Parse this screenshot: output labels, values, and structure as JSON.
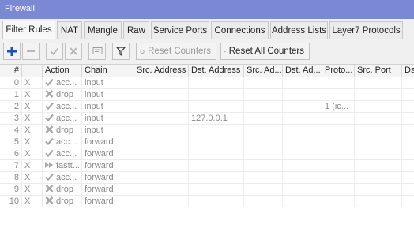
{
  "window": {
    "title": "Firewall"
  },
  "tabs": [
    {
      "label": "Filter Rules",
      "active": true
    },
    {
      "label": "NAT",
      "active": false
    },
    {
      "label": "Mangle",
      "active": false
    },
    {
      "label": "Raw",
      "active": false
    },
    {
      "label": "Service Ports",
      "active": false
    },
    {
      "label": "Connections",
      "active": false
    },
    {
      "label": "Address Lists",
      "active": false
    },
    {
      "label": "Layer7 Protocols",
      "active": false
    }
  ],
  "toolbar": {
    "reset_counters": "Reset Counters",
    "reset_all_counters": "Reset All Counters"
  },
  "table": {
    "columns": [
      "#",
      "",
      "Action",
      "Chain",
      "Src. Address",
      "Dst. Address",
      "Src. Ad...",
      "Dst. Ad...",
      "Proto...",
      "Src. Port",
      "Ds"
    ],
    "rows": [
      {
        "num": "0",
        "flag": "X",
        "action": "acc...",
        "action_icon": "accept-icon",
        "chain": "input",
        "src": "",
        "dst": "",
        "src_list": "",
        "dst_list": "",
        "proto": "",
        "sport": ""
      },
      {
        "num": "1",
        "flag": "X",
        "action": "drop",
        "action_icon": "drop-icon",
        "chain": "input",
        "src": "",
        "dst": "",
        "src_list": "",
        "dst_list": "",
        "proto": "",
        "sport": ""
      },
      {
        "num": "2",
        "flag": "X",
        "action": "acc...",
        "action_icon": "accept-icon",
        "chain": "input",
        "src": "",
        "dst": "",
        "src_list": "",
        "dst_list": "",
        "proto": "1 (ic...",
        "sport": ""
      },
      {
        "num": "3",
        "flag": "X",
        "action": "acc...",
        "action_icon": "accept-icon",
        "chain": "input",
        "src": "",
        "dst": "127.0.0.1",
        "src_list": "",
        "dst_list": "",
        "proto": "",
        "sport": ""
      },
      {
        "num": "4",
        "flag": "X",
        "action": "drop",
        "action_icon": "drop-icon",
        "chain": "input",
        "src": "",
        "dst": "",
        "src_list": "",
        "dst_list": "",
        "proto": "",
        "sport": ""
      },
      {
        "num": "5",
        "flag": "X",
        "action": "acc...",
        "action_icon": "accept-icon",
        "chain": "forward",
        "src": "",
        "dst": "",
        "src_list": "",
        "dst_list": "",
        "proto": "",
        "sport": ""
      },
      {
        "num": "6",
        "flag": "X",
        "action": "acc...",
        "action_icon": "accept-icon",
        "chain": "forward",
        "src": "",
        "dst": "",
        "src_list": "",
        "dst_list": "",
        "proto": "",
        "sport": ""
      },
      {
        "num": "7",
        "flag": "X",
        "action": "fastt...",
        "action_icon": "fasttrack-icon",
        "chain": "forward",
        "src": "",
        "dst": "",
        "src_list": "",
        "dst_list": "",
        "proto": "",
        "sport": ""
      },
      {
        "num": "8",
        "flag": "X",
        "action": "acc...",
        "action_icon": "accept-icon",
        "chain": "forward",
        "src": "",
        "dst": "",
        "src_list": "",
        "dst_list": "",
        "proto": "",
        "sport": ""
      },
      {
        "num": "9",
        "flag": "X",
        "action": "drop",
        "action_icon": "drop-icon",
        "chain": "forward",
        "src": "",
        "dst": "",
        "src_list": "",
        "dst_list": "",
        "proto": "",
        "sport": ""
      },
      {
        "num": "10",
        "flag": "X",
        "action": "drop",
        "action_icon": "drop-icon",
        "chain": "forward",
        "src": "",
        "dst": "",
        "src_list": "",
        "dst_list": "",
        "proto": "",
        "sport": ""
      }
    ]
  }
}
